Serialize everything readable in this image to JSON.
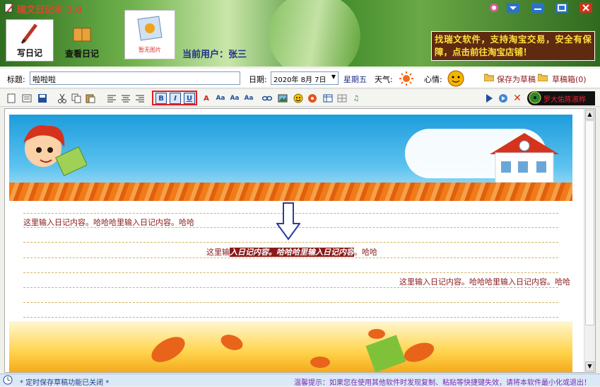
{
  "app": {
    "title": "瑞文日记本 3.0"
  },
  "nav": {
    "write_label": "写日记",
    "view_label": "查看日记"
  },
  "photo": {
    "caption": "暂无图片"
  },
  "user": {
    "label": "当前用户：张三"
  },
  "ad": {
    "text": "找瑞文软件，支持淘宝交易，安全有保障，点击前往淘宝店铺！"
  },
  "form": {
    "title_label": "标题:",
    "title_value": "啦啦啦",
    "date_label": "日期:",
    "date_value": "2020年 8月 7日",
    "weekday": "星期五",
    "weather_label": "天气:",
    "mood_label": "心情:",
    "save_draft": "保存为草稿",
    "drafts": "草稿箱(0)"
  },
  "music": {
    "label": "罗大佑陈淑桦"
  },
  "editor": {
    "line1": "这里输入日记内容。哈哈哈里输入日记内容。哈哈",
    "line2_pre": "这里输",
    "line2_sel": "入日记内容。哈哈哈里输入日记内容",
    "line2_post": "。哈哈",
    "line3": "这里输入日记内容。哈哈哈里输入日记内容。哈哈"
  },
  "status": {
    "autosave": "* 定时保存草稿功能已关闭 *",
    "tip": "温馨提示：如果您在使用其他软件时发现复制、粘贴等快捷键失效，请将本软件最小化或退出！"
  },
  "colors": {
    "accent_text": "#8a1a1a",
    "ad_bg": "#5e2a10",
    "ad_text": "#ffdf3b",
    "user_text": "#1d2e8a"
  }
}
